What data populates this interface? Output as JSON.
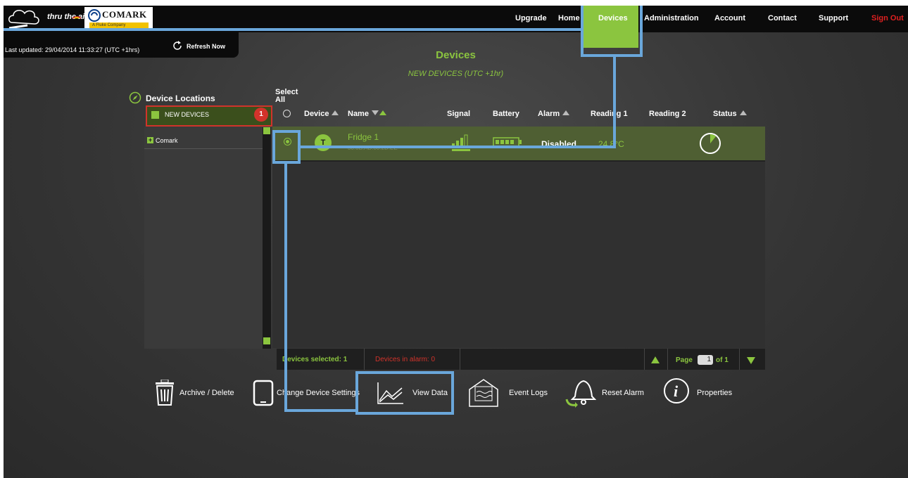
{
  "header": {
    "tagline": "thru the air",
    "brand": "COMARK",
    "brand_sub": "A Fluke Company",
    "nav": [
      "Upgrade",
      "Home",
      "Devices",
      "Administration",
      "Account",
      "Contact",
      "Support",
      "Sign Out"
    ],
    "active_nav": "Devices"
  },
  "status": {
    "last_updated": "Last updated: 29/04/2014 11:33:27 (UTC +1hrs)",
    "refresh_label": "Refresh Now"
  },
  "page": {
    "title": "Devices",
    "subtitle": "NEW DEVICES  (UTC +1hr)"
  },
  "locations": {
    "header": "Device Locations",
    "group_label": "NEW DEVICES",
    "group_badge": "1",
    "tree_item": "Comark"
  },
  "table": {
    "select_all": "Select All",
    "columns": [
      "Device",
      "Name",
      "Signal",
      "Battery",
      "Alarm",
      "Reading 1",
      "Reading 2",
      "Status"
    ],
    "rows": [
      {
        "device_letter": "T",
        "name": "Fridge 1",
        "id": "30:0B:AD:00:2D:EE",
        "alarm": "Disabled",
        "reading1": "24.8°C",
        "reading2": ""
      }
    ]
  },
  "footer": {
    "selected": "Devices selected: 1",
    "in_alarm": "Devices in alarm: 0",
    "page_label": "Page",
    "page_value": "1",
    "page_of": "of 1"
  },
  "actions": [
    "Archive / Delete",
    "Change Device Settings",
    "View Data",
    "Event Logs",
    "Reset Alarm",
    "Properties"
  ],
  "colors": {
    "accent": "#8bc53f",
    "alert": "#d1332b",
    "highlight": "#6aa7db"
  }
}
